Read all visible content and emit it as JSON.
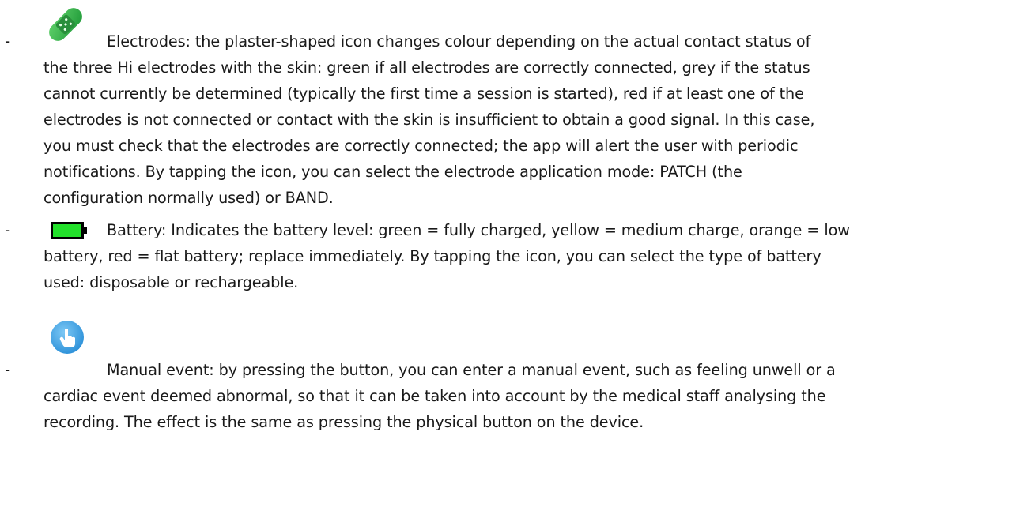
{
  "items": [
    {
      "bullet": "-",
      "icon": "plaster-icon",
      "icon_color": "#2fae45",
      "text": "Electrodes: the plaster-shaped icon changes colour depending on the actual contact status of\nthe three Hi electrodes with the skin: green if all electrodes are correctly connected, grey if the status\ncannot currently be determined (typically the first time a session is started), red if at least one of the\nelectrodes is not connected or contact with the skin is insufficient to obtain a good signal. In this case,\nyou must check that the electrodes are correctly connected; the app will alert the user with periodic\nnotifications. By tapping the icon, you can select the electrode application mode: PATCH (the\nconfiguration normally used) or BAND."
    },
    {
      "bullet": "-",
      "icon": "battery-icon",
      "icon_color": "#22e02a",
      "text": "Battery: Indicates the battery level: green = fully charged, yellow = medium charge, orange = low\nbattery, red = flat battery; replace immediately. By tapping the icon, you can select the type of battery\nused: disposable or rechargeable."
    },
    {
      "bullet": "-",
      "icon": "touch-hand-icon",
      "icon_color": "#3aa6e8",
      "text": "Manual event: by pressing the button, you can enter a manual event, such as feeling unwell or a\ncardiac event deemed abnormal, so that it can be taken into account by the medical staff analysing the\nrecording. The effect is the same as pressing the physical button on the device."
    }
  ]
}
